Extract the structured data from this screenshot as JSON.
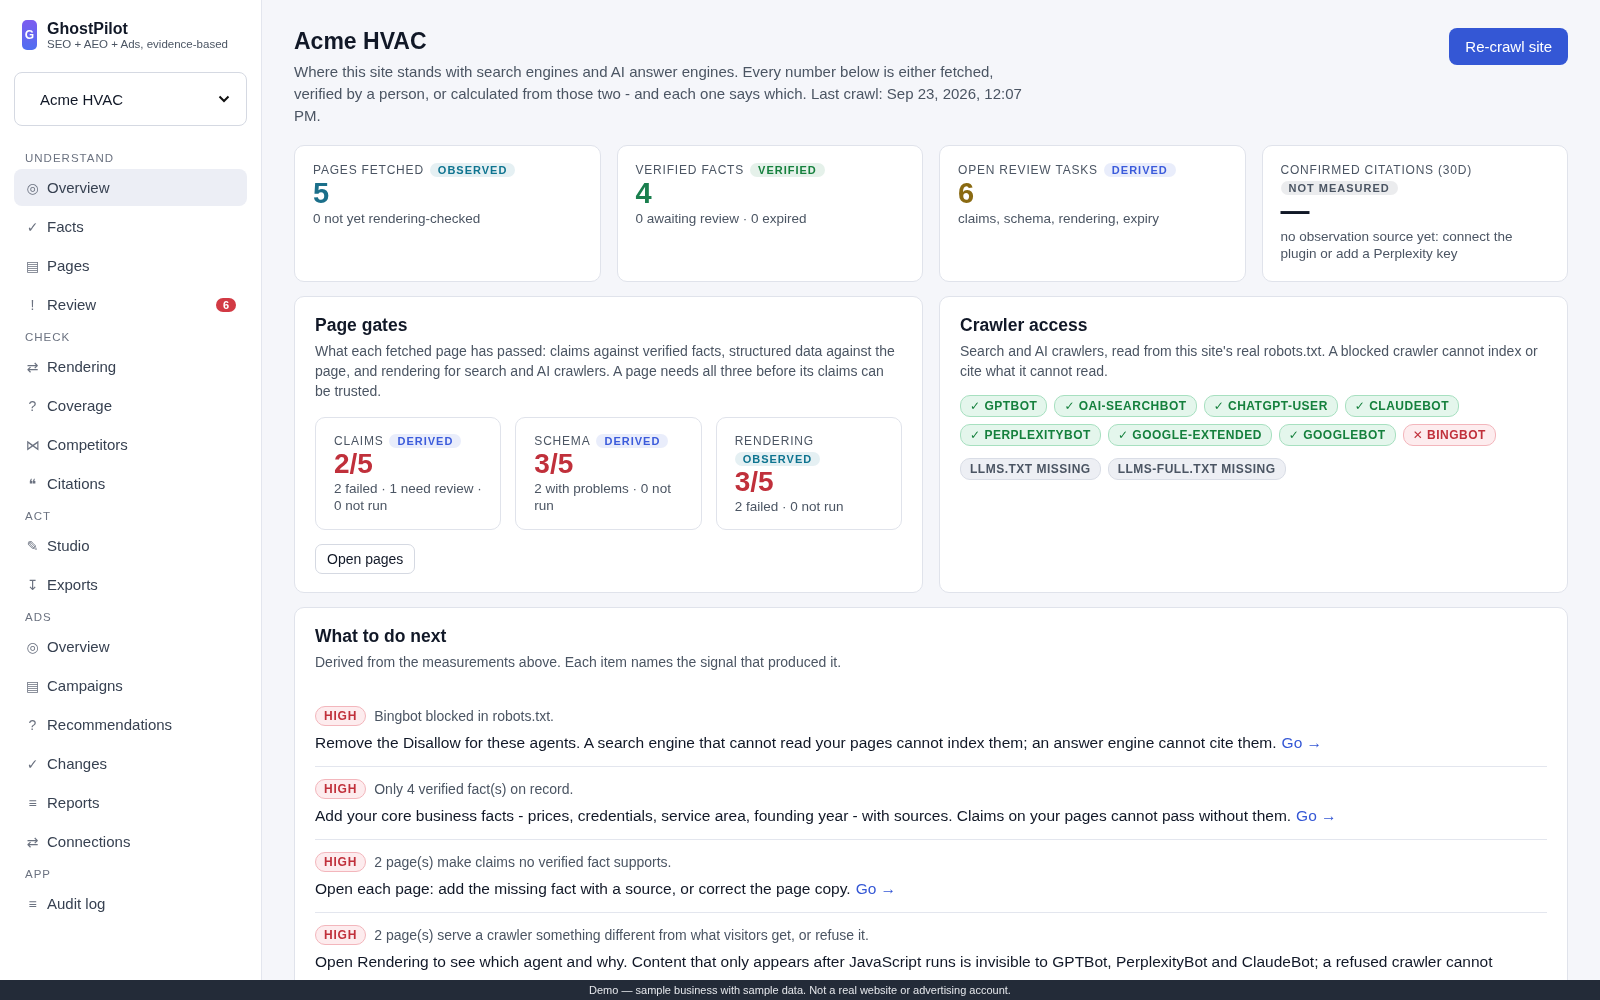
{
  "brand": {
    "logo": "G",
    "name": "GhostPilot",
    "tagline": "SEO + AEO + Ads, evidence-based"
  },
  "site_selector": {
    "value": "Acme HVAC"
  },
  "sidebar": {
    "sections": [
      {
        "heading": "UNDERSTAND",
        "items": [
          {
            "glyph": "◎",
            "label": "Overview",
            "selected": true
          },
          {
            "glyph": "✓",
            "label": "Facts",
            "selected": false
          },
          {
            "glyph": "▤",
            "label": "Pages",
            "selected": false
          },
          {
            "glyph": "!",
            "label": "Review",
            "selected": false,
            "badge": "6"
          }
        ]
      },
      {
        "heading": "CHECK",
        "items": [
          {
            "glyph": "⇄",
            "label": "Rendering",
            "selected": false
          },
          {
            "glyph": "?",
            "label": "Coverage",
            "selected": false
          },
          {
            "glyph": "⋈",
            "label": "Competitors",
            "selected": false
          },
          {
            "glyph": "❝",
            "label": "Citations",
            "selected": false
          }
        ]
      },
      {
        "heading": "ACT",
        "items": [
          {
            "glyph": "✎",
            "label": "Studio",
            "selected": false
          },
          {
            "glyph": "↧",
            "label": "Exports",
            "selected": false
          }
        ]
      },
      {
        "heading": "ADS",
        "items": [
          {
            "glyph": "◎",
            "label": "Overview",
            "selected": false
          },
          {
            "glyph": "▤",
            "label": "Campaigns",
            "selected": false
          },
          {
            "glyph": "?",
            "label": "Recommendations",
            "selected": false
          },
          {
            "glyph": "✓",
            "label": "Changes",
            "selected": false
          },
          {
            "glyph": "≡",
            "label": "Reports",
            "selected": false
          },
          {
            "glyph": "⇄",
            "label": "Connections",
            "selected": false
          }
        ]
      },
      {
        "heading": "APP",
        "items": [
          {
            "glyph": "≡",
            "label": "Audit log",
            "selected": false
          }
        ]
      }
    ]
  },
  "header": {
    "title": "Acme HVAC",
    "description": "Where this site stands with search engines and AI answer engines. Every number below is either fetched, verified by a person, or calculated from those two - and each one says which. Last crawl: Sep 23, 2026, 12:07 PM.",
    "action": "Re-crawl site"
  },
  "stats": [
    {
      "label": "PAGES FETCHED",
      "badge": {
        "text": "OBSERVED",
        "color": "#0e7490"
      },
      "value": "5",
      "color": "#1b6f8a",
      "note": "0 not yet rendering-checked"
    },
    {
      "label": "VERIFIED FACTS",
      "badge": {
        "text": "VERIFIED",
        "color": "#15803d"
      },
      "value": "4",
      "color": "#1a7f4e",
      "note": "0 awaiting review · 0 expired"
    },
    {
      "label": "OPEN REVIEW TASKS",
      "badge": {
        "text": "DERIVED",
        "color": "#3b5bdb"
      },
      "value": "6",
      "color": "#8a6a12",
      "note": "claims, schema, rendering, expiry"
    },
    {
      "label": "CONFIRMED CITATIONS (30D)",
      "badge": {
        "text": "NOT MEASURED",
        "color": "#4b5563"
      },
      "value": "—",
      "color": "#111827",
      "note": "no observation source yet: connect the plugin or add a Perplexity key"
    }
  ],
  "page_gates": {
    "title": "Page gates",
    "description": "What each fetched page has passed: claims against verified facts, structured data against the page, and rendering for search and AI crawlers. A page needs all three before its claims can be trusted.",
    "gates": [
      {
        "label": "CLAIMS",
        "badge": {
          "text": "DERIVED",
          "color": "#3b5bdb"
        },
        "value": "2/5",
        "note": "2 failed · 1 need review · 0 not run"
      },
      {
        "label": "SCHEMA",
        "badge": {
          "text": "DERIVED",
          "color": "#3b5bdb"
        },
        "value": "3/5",
        "note": "2 with problems · 0 not run"
      },
      {
        "label": "RENDERING",
        "badge": {
          "text": "OBSERVED",
          "color": "#0e7490"
        },
        "value": "3/5",
        "note": "2 failed · 0 not run"
      }
    ],
    "action": "Open pages"
  },
  "crawler_access": {
    "title": "Crawler access",
    "description": "Search and AI crawlers, read from this site's real robots.txt. A blocked crawler cannot index or cite what it cannot read.",
    "crawlers": [
      {
        "text": "✓ GPTBOT",
        "kind": "allowed"
      },
      {
        "text": "✓ OAI-SEARCHBOT",
        "kind": "allowed"
      },
      {
        "text": "✓ CHATGPT-USER",
        "kind": "allowed"
      },
      {
        "text": "✓ CLAUDEBOT",
        "kind": "allowed"
      },
      {
        "text": "✓ PERPLEXITYBOT",
        "kind": "allowed"
      },
      {
        "text": "✓ GOOGLE-EXTENDED",
        "kind": "allowed"
      },
      {
        "text": "✓ GOOGLEBOT",
        "kind": "allowed"
      },
      {
        "text": "✕ BINGBOT",
        "kind": "blocked"
      }
    ],
    "files": [
      {
        "text": "LLMS.TXT MISSING",
        "kind": "missing"
      },
      {
        "text": "LLMS-FULL.TXT MISSING",
        "kind": "missing"
      }
    ]
  },
  "next_steps": {
    "title": "What to do next",
    "description": "Derived from the measurements above. Each item names the signal that produced it.",
    "items": [
      {
        "priority": "HIGH",
        "signal": "Bingbot blocked in robots.txt.",
        "action": "Remove the Disallow for these agents. A search engine that cannot read your pages cannot index them; an answer engine cannot cite them.",
        "link": "Go →"
      },
      {
        "priority": "HIGH",
        "signal": "Only 4 verified fact(s) on record.",
        "action": "Add your core business facts - prices, credentials, service area, founding year - with sources. Claims on your pages cannot pass without them.",
        "link": "Go →"
      },
      {
        "priority": "HIGH",
        "signal": "2 page(s) make claims no verified fact supports.",
        "action": "Open each page: add the missing fact with a source, or correct the page copy.",
        "link": "Go →"
      },
      {
        "priority": "HIGH",
        "signal": "2 page(s) serve a crawler something different from what visitors get, or refuse it.",
        "action": "Open Rendering to see which agent and why. Content that only appears after JavaScript runs is invisible to GPTBot, PerplexityBot and ClaudeBot; a refused crawler cannot"
      }
    ]
  },
  "footer": "Demo — sample business with sample data. Not a real website or advertising account."
}
